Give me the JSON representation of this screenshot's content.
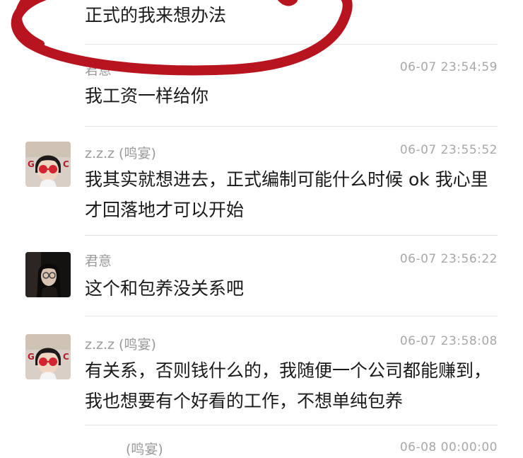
{
  "messages": [
    {
      "sender": "",
      "time": "",
      "text": "正式的我来想办法"
    },
    {
      "sender": "君意",
      "time": "06-07 23:54:59",
      "text": "我工资一样给你"
    },
    {
      "sender": "z.z.z (鸣宴)",
      "time": "06-07 23:55:52",
      "text": "我其实就想进去，正式编制可能什么时候 ok 我心里才回落地才可以开始"
    },
    {
      "sender": "君意",
      "time": "06-07 23:56:22",
      "text": "这个和包养没关系吧"
    },
    {
      "sender": "z.z.z (鸣宴)",
      "time": "06-07 23:58:08",
      "text": "有关系，否则钱什么的，我随便一个公司都能赚到，我也想要有个好看的工作，不想单纯包养"
    },
    {
      "sender": "(鸣宴)",
      "time": "06-08 00:00:00",
      "text": ""
    }
  ],
  "avatars": {
    "zzz": "girl-with-red-sunglasses-avatar",
    "junyi": "dark-portrait-avatar"
  },
  "colors": {
    "annotation": "#b8141f",
    "text": "#1a1a1a",
    "meta": "#9a9a9a",
    "divider": "#e3e3e3"
  }
}
